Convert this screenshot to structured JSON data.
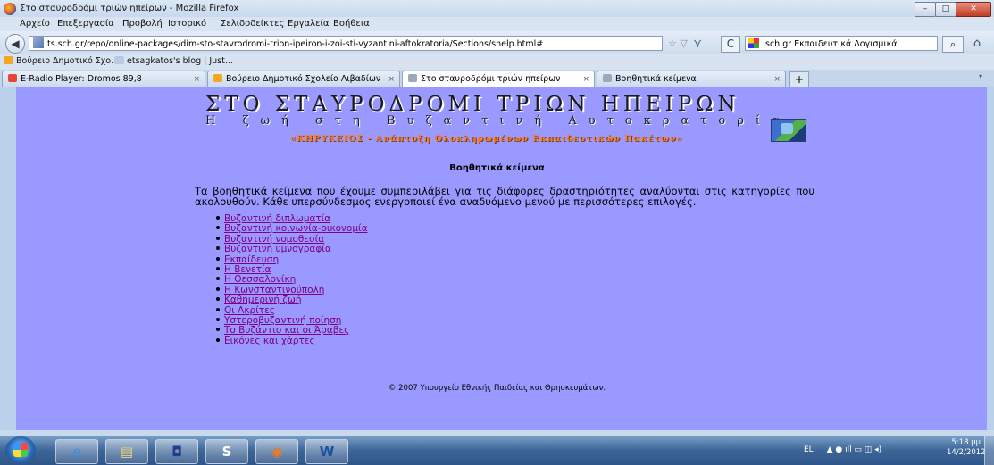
{
  "window": {
    "title": "Στο σταυροδρόμι τριών ηπείρων - Mozilla Firefox",
    "min_glyph": "–",
    "max_glyph": "□",
    "close_glyph": "✕"
  },
  "menu": [
    "Αρχείο",
    "Επεξεργασία",
    "Προβολή",
    "Ιστορικό",
    "Σελιδοδείκτες",
    "Εργαλεία",
    "Βοήθεια"
  ],
  "nav": {
    "back_glyph": "◀",
    "url": "ts.sch.gr/repo/online-packages/dim-sto-stavrodromi-trion-ipeiron-i-zoi-sti-vyzantini-aftokratoria/Sections/shelp.html#",
    "star_glyph": "☆ ▽",
    "bookmark_glyph": "⋎",
    "reload_glyph": "C",
    "search_engine": "sch.gr Εκπαιδευτικά Λογισμικά",
    "search_glyph": "⌕",
    "home_glyph": "⌂"
  },
  "bookmarks": [
    "Βούρειο Δημοτικό Σχο...",
    "etsagkatos's blog | Just..."
  ],
  "tabs": [
    {
      "label": "E-Radio Player: Dromos 89,8",
      "color": "#e8443a"
    },
    {
      "label": "Βούρειο Δημοτικό Σχολείο Λιβαδίων",
      "color": "#f5a623"
    },
    {
      "label": "Στο σταυροδρόμι τριών ηπείρων",
      "color": "#9ab"
    },
    {
      "label": "Βοηθητικά κείμενα",
      "color": "#9ab"
    }
  ],
  "tab_close_glyph": "×",
  "new_tab_glyph": "+",
  "tab_list_glyph": "▾",
  "page": {
    "site_title": "ΣΤΟ ΣΤΑΥΡΟΔΡΟΜΙ ΤΡΙΩΝ ΗΠΕΙΡΩΝ",
    "site_subtitle": "Η ζωή στη Βυζαντινή Αυτοκρατορία",
    "banner": "«ΚΗΡΥΚΕΙΟΣ - Ανάπτυξη Ολοκληρωμένων Εκπαιδευτικών Πακέτων»",
    "heading": "Βοηθητικά κείμενα",
    "intro": "Τα βοηθητικά κείμενα που έχουμε συμπεριλάβει για τις διάφορες δραστηριότητες αναλύονται στις κατηγορίες που ακολουθούν. Κάθε υπερσύνδεσμος ενεργοποιεί ένα αναδυόμενο μενού με περισσότερες επιλογές.",
    "links": [
      "Βυζαντινή διπλωματία",
      "Βυζαντινή κοινωνία-οικονομία",
      "Βυζαντινή νομοθεσία",
      "Βυζαντινή υμνογραφία",
      "Εκπαίδευση",
      "Η Βενετία",
      "Η Θεσσαλονίκη",
      "Η Κωνσταντινούπολη",
      "Καθημερινή ζωή",
      "Οι Ακρίτες",
      "Υστεροβυζαντινή ποίηση",
      "Το Βυζάντιο και οι Άραβες",
      "Εικόνες και χάρτες"
    ],
    "footer": "© 2007 Υπουργείο Εθνικής Παιδείας και Θρησκευμάτων."
  },
  "taskbar": {
    "apps": [
      {
        "name": "internet-explorer",
        "glyph": "e"
      },
      {
        "name": "file-explorer",
        "glyph": "▤"
      },
      {
        "name": "media-player",
        "glyph": "◘"
      },
      {
        "name": "skype",
        "glyph": "S"
      },
      {
        "name": "firefox",
        "glyph": "◉"
      },
      {
        "name": "word",
        "glyph": "W"
      }
    ],
    "tray_lang": "EL",
    "tray_icons": "▲ ● ıll ▭ ◫ ◂)",
    "time": "5:18 μμ",
    "date": "14/2/2012"
  }
}
